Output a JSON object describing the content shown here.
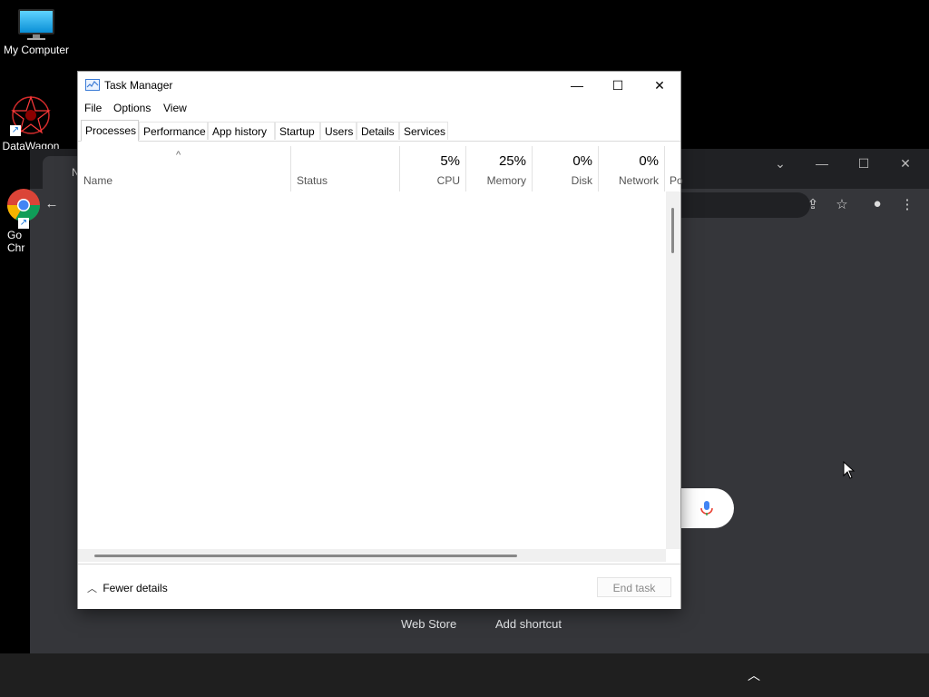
{
  "desktop": {
    "icons": [
      {
        "label": "My Computer"
      },
      {
        "label": "DataWagon"
      },
      {
        "label": "Go\nChr"
      }
    ]
  },
  "chrome": {
    "tab_label": "N",
    "links": [
      "Web Store",
      "Add shortcut"
    ]
  },
  "task_manager": {
    "title": "Task Manager",
    "menu": [
      "File",
      "Options",
      "View"
    ],
    "tabs": [
      "Processes",
      "Performance",
      "App history",
      "Startup",
      "Users",
      "Details",
      "Services"
    ],
    "active_tab": "Processes",
    "columns": [
      {
        "name": "Name",
        "pct": ""
      },
      {
        "name": "Status",
        "pct": ""
      },
      {
        "name": "CPU",
        "pct": "5%"
      },
      {
        "name": "Memory",
        "pct": "25%"
      },
      {
        "name": "Disk",
        "pct": "0%"
      },
      {
        "name": "Network",
        "pct": "0%"
      },
      {
        "name": "Po",
        "pct": ""
      }
    ],
    "footer": {
      "fewer_details": "Fewer details",
      "end_task": "End task"
    }
  },
  "colors": {
    "desktop_bg": "#000000",
    "chrome_bg": "#35363a",
    "taskbar_bg": "#1f1f1f"
  }
}
